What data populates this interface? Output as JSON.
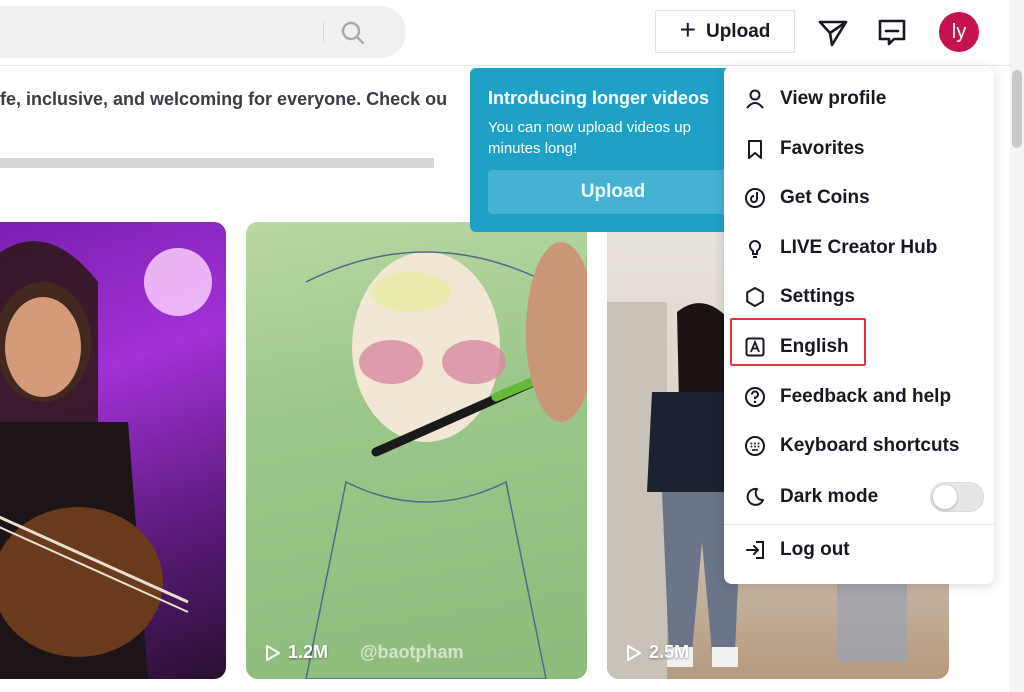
{
  "header": {
    "upload_label": "Upload",
    "avatar_initials": "ly"
  },
  "notice": {
    "text": "fe, inclusive, and welcoming for everyone. Check ou"
  },
  "promo": {
    "title": "Introducing longer videos",
    "body": "You can now upload videos up to 10 minutes long!",
    "body_visible": "You can now upload videos up",
    "body_line2": "minutes long!",
    "button_label": "Upload"
  },
  "menu": {
    "items": [
      {
        "label": "View profile",
        "icon": "person-icon"
      },
      {
        "label": "Favorites",
        "icon": "bookmark-icon"
      },
      {
        "label": "Get Coins",
        "icon": "coin-icon"
      },
      {
        "label": "LIVE Creator Hub",
        "icon": "bulb-icon"
      },
      {
        "label": "Settings",
        "icon": "gear-icon"
      },
      {
        "label": "English",
        "icon": "language-icon"
      },
      {
        "label": "Feedback and help",
        "icon": "help-icon"
      },
      {
        "label": "Keyboard shortcuts",
        "icon": "keyboard-icon"
      },
      {
        "label": "Dark mode",
        "icon": "moon-icon"
      },
      {
        "label": "Log out",
        "icon": "logout-icon"
      }
    ],
    "dark_mode_on": false
  },
  "videos": [
    {
      "views": ""
    },
    {
      "views": "1.2M",
      "watermark": "@baotpham"
    },
    {
      "views": "2.5M"
    }
  ],
  "colors": {
    "accent": "#fe2c55",
    "avatar": "#c4134d",
    "promo": "#1ea0c7",
    "highlight": "#e2333f"
  }
}
